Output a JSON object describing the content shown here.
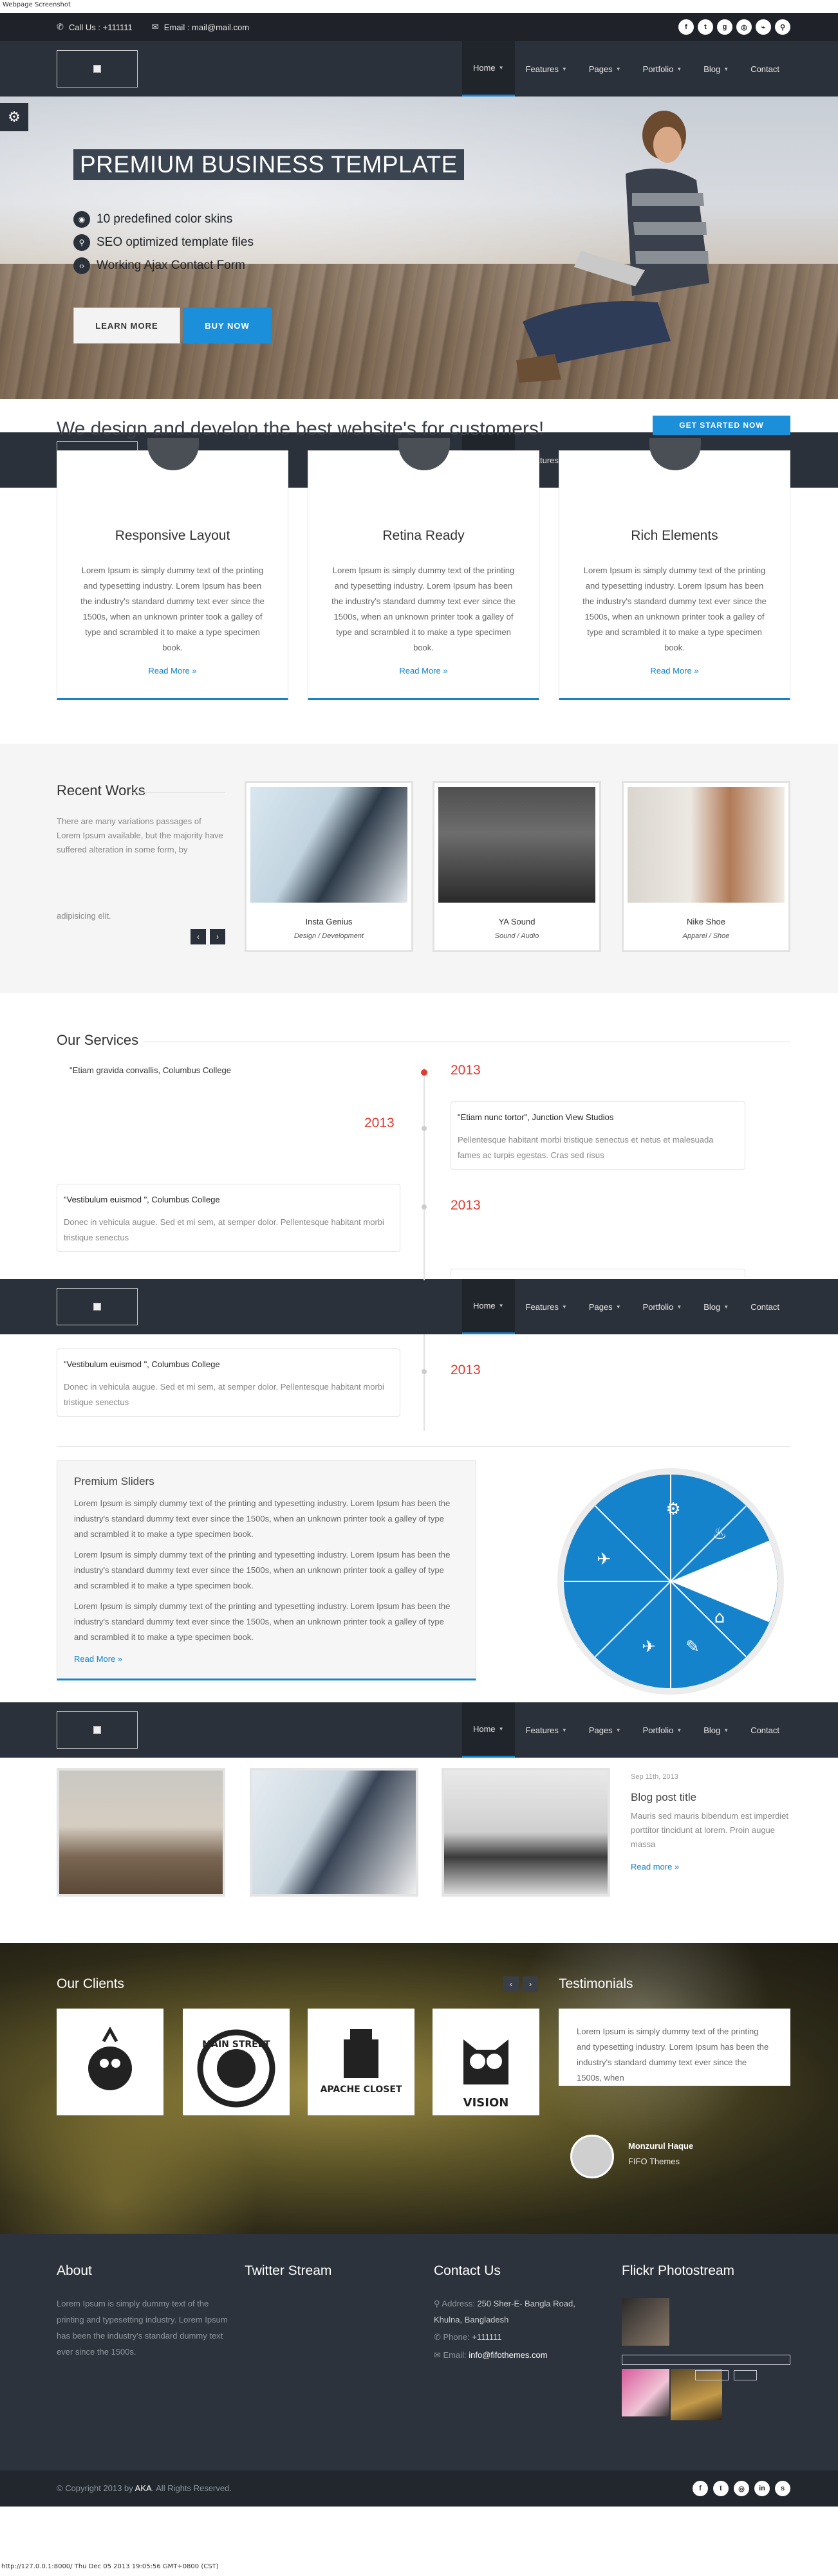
{
  "screenshot_caption": "Webpage Screenshot",
  "topbar": {
    "phone": "Call Us : +111111",
    "email": "Email : mail@mail.com",
    "social_icons": [
      "facebook-icon",
      "twitter-icon",
      "google-plus-icon",
      "dribbble-icon",
      "rss-icon",
      "search-icon"
    ]
  },
  "nav": {
    "items": [
      {
        "label": "Home",
        "caret": true,
        "active": true
      },
      {
        "label": "Features",
        "caret": true
      },
      {
        "label": "Pages",
        "caret": true
      },
      {
        "label": "Portfolio",
        "caret": true
      },
      {
        "label": "Blog",
        "caret": true
      },
      {
        "label": "Contact",
        "caret": false
      }
    ]
  },
  "hero": {
    "title": "PREMIUM BUSINESS TEMPLATE",
    "features": [
      "10 predefined color skins",
      "SEO optimized template files",
      "Working Ajax Contact Form"
    ],
    "learn_more": "LEARN MORE",
    "buy_now": "BUY NOW"
  },
  "tagline": {
    "text": "We design and develop the best website's for customers!",
    "cta": "GET STARTED NOW"
  },
  "services_cards": [
    {
      "title": "Responsive Layout",
      "body": "Lorem Ipsum is simply dummy text of the printing and typesetting industry. Lorem Ipsum has been the industry's standard dummy text ever since the 1500s, when an unknown printer took a galley of type and scrambled it to make a type specimen book.",
      "more": "Read More »"
    },
    {
      "title": "Retina Ready",
      "body": "Lorem Ipsum is simply dummy text of the printing and typesetting industry. Lorem Ipsum has been the industry's standard dummy text ever since the 1500s, when an unknown printer took a galley of type and scrambled it to make a type specimen book.",
      "more": "Read More »"
    },
    {
      "title": "Rich Elements",
      "body": "Lorem Ipsum is simply dummy text of the printing and typesetting industry. Lorem Ipsum has been the industry's standard dummy text ever since the 1500s, when an unknown printer took a galley of type and scrambled it to make a type specimen book.",
      "more": "Read More »"
    }
  ],
  "recent_works": {
    "title": "Recent Works",
    "text_top": "There are many variations passages of Lorem Ipsum available, but the majority have suffered alteration in some form, by",
    "text_bottom": "adipisicing elit.",
    "items": [
      {
        "name": "Insta Genius",
        "category": "Design / Development"
      },
      {
        "name": "YA Sound",
        "category": "Sound / Audio"
      },
      {
        "name": "Nike Shoe",
        "category": "Apparel / Shoe"
      }
    ]
  },
  "our_services": {
    "title": "Our Services",
    "quote1": "\"Etiam gravida convallis, Columbus College",
    "year1": "2013",
    "year2": "2013",
    "box2_title": "\"Etiam nunc tortor\", Junction View Studios",
    "box2_desc": "Pellentesque habitant morbi tristique senectus et netus et malesuada fames ac turpis egestas. Cras sed risus",
    "box3_title": "\"Vestibulum euismod \", Columbus College",
    "box3_desc": "Donec in vehicula augue. Sed et mi sem, at semper dolor. Pellentesque habitant morbi tristique senectus",
    "year3": "2013",
    "box4_title": "\"Vestibulum euismod \", Columbus College",
    "box4_desc": "Donec in vehicula augue. Sed et mi sem, at semper dolor. Pellentesque habitant morbi tristique senectus",
    "year4": "2013"
  },
  "premium_sliders": {
    "title": "Premium Sliders",
    "p1": "Lorem Ipsum is simply dummy text of the printing and typesetting industry. Lorem Ipsum has been the industry's standard dummy text ever since the 1500s, when an unknown printer took a galley of type and scrambled it to make a type specimen book.",
    "p2": "Lorem Ipsum is simply dummy text of the printing and typesetting industry. Lorem Ipsum has been the industry's standard dummy text ever since the 1500s, when an unknown printer took a galley of type and scrambled it to make a type specimen book.",
    "p3": "Lorem Ipsum is simply dummy text of the printing and typesetting industry. Lorem Ipsum has been the industry's standard dummy text ever since the 1500s, when an unknown printer took a galley of type and scrambled it to make a type specimen book.",
    "more": "Read More »",
    "wheel_icons": [
      "cogs-icon",
      "bag-icon",
      "page-icon",
      "tag-icon",
      "ruler-icon",
      "megaphone-icon",
      "shield-icon",
      "plane-icon"
    ]
  },
  "blog": {
    "date": "Sep 11th, 2013",
    "title": "Blog post title",
    "excerpt": "Mauris sed mauris bibendum est imperdiet porttitor tincidunt at lorem. Proin augue massa",
    "more": "Read more »"
  },
  "clients": {
    "title": "Our Clients",
    "logos": [
      "bird-logo",
      "main-street-logo",
      "apache-closet-logo",
      "vision-owl-logo"
    ],
    "logo_texts": [
      "MAIN STREET",
      "APACHE CLOSET",
      "VISION"
    ]
  },
  "testimonials": {
    "title": "Testimonials",
    "text": "Lorem Ipsum is simply dummy text of the printing and typesetting industry. Lorem Ipsum has been the industry's standard dummy text ever since the 1500s, when",
    "author": "Monzurul Haque",
    "company": "FIFO Themes"
  },
  "footer": {
    "about_title": "About",
    "about_text": "Lorem Ipsum is simply dummy text of the printing and typesetting industry. Lorem Ipsum has been the industry's standard dummy text ever since the 1500s.",
    "twitter_title": "Twitter Stream",
    "contact_title": "Contact Us",
    "address_label": "Address:",
    "address_value": "250 Sher-E- Bangla Road, Khulna, Bangladesh",
    "phone_label": "Phone:",
    "phone_value": "+111111",
    "email_label": "Email:",
    "email_value": "info@fifothemes.com",
    "flickr_title": "Flickr Photostream"
  },
  "bottom": {
    "copyright_prefix": "© Copyright 2013 by ",
    "brand": "AKA",
    "copyright_suffix": ". All Rights Reserved."
  },
  "status_url": "http://127.0.0.1:8000/ Thu Dec 05 2013 19:05:56 GMT+0800 (CST)",
  "colors": {
    "accent": "#1583cc",
    "dark": "#2b313a",
    "year": "#e03c31"
  }
}
